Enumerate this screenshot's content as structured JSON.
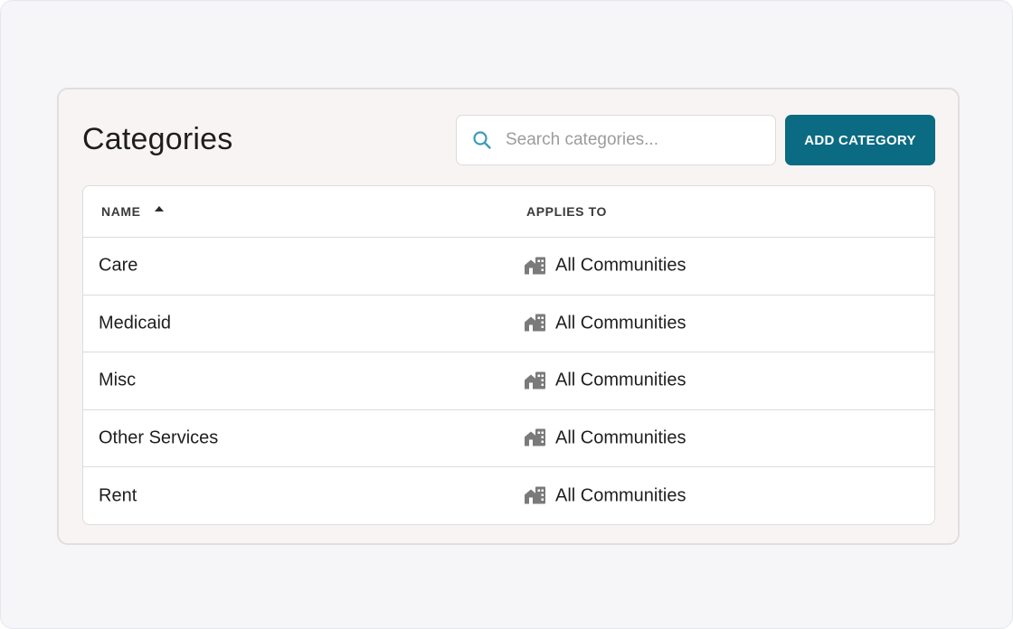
{
  "page": {
    "title": "Categories"
  },
  "search": {
    "placeholder": "Search categories...",
    "value": "",
    "icon": "search-icon"
  },
  "toolbar": {
    "add_label": "ADD CATEGORY",
    "accent": "#0b6b82"
  },
  "table": {
    "columns": [
      {
        "label": "NAME",
        "sort": "ascending"
      },
      {
        "label": "APPLIES TO"
      }
    ],
    "rows": [
      {
        "name": "Care",
        "applies_to": "All Communities",
        "icon": "community-icon"
      },
      {
        "name": "Medicaid",
        "applies_to": "All Communities",
        "icon": "community-icon"
      },
      {
        "name": "Misc",
        "applies_to": "All Communities",
        "icon": "community-icon"
      },
      {
        "name": "Other Services",
        "applies_to": "All Communities",
        "icon": "community-icon"
      },
      {
        "name": "Rent",
        "applies_to": "All Communities",
        "icon": "community-icon"
      }
    ]
  }
}
